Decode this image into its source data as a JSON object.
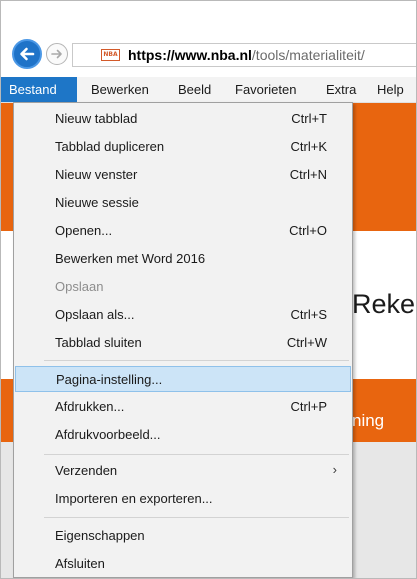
{
  "browser": {
    "url_scheme": "https://",
    "url_host": "www.nba.nl",
    "url_path": "/tools/materialiteit/",
    "favicon_text": "NBA"
  },
  "menubar": {
    "items": [
      "Bestand",
      "Bewerken",
      "Beeld",
      "Favorieten",
      "Extra",
      "Help"
    ]
  },
  "page": {
    "headline": "Reke",
    "band_text": "ning"
  },
  "file_menu": {
    "items": [
      {
        "label": "Nieuw tabblad",
        "shortcut": "Ctrl+T"
      },
      {
        "label": "Tabblad dupliceren",
        "shortcut": "Ctrl+K"
      },
      {
        "label": "Nieuw venster",
        "shortcut": "Ctrl+N"
      },
      {
        "label": "Nieuwe sessie",
        "shortcut": ""
      },
      {
        "label": "Openen...",
        "shortcut": "Ctrl+O"
      },
      {
        "label": "Bewerken met Word 2016",
        "shortcut": ""
      },
      {
        "label": "Opslaan",
        "shortcut": ""
      },
      {
        "label": "Opslaan als...",
        "shortcut": "Ctrl+S"
      },
      {
        "label": "Tabblad sluiten",
        "shortcut": "Ctrl+W"
      },
      {
        "label": "Pagina-instelling...",
        "shortcut": ""
      },
      {
        "label": "Afdrukken...",
        "shortcut": "Ctrl+P"
      },
      {
        "label": "Afdrukvoorbeeld...",
        "shortcut": ""
      },
      {
        "label": "Verzenden",
        "shortcut": ""
      },
      {
        "label": "Importeren en exporteren...",
        "shortcut": ""
      },
      {
        "label": "Eigenschappen",
        "shortcut": ""
      },
      {
        "label": "Afsluiten",
        "shortcut": ""
      }
    ],
    "highlighted_item": "Pagina-instelling...",
    "disabled_item": "Opslaan",
    "submenu_item": "Verzenden"
  },
  "colors": {
    "accent": "#1e76c7",
    "brand_orange": "#e8650f",
    "highlight": "#cce4f7"
  }
}
